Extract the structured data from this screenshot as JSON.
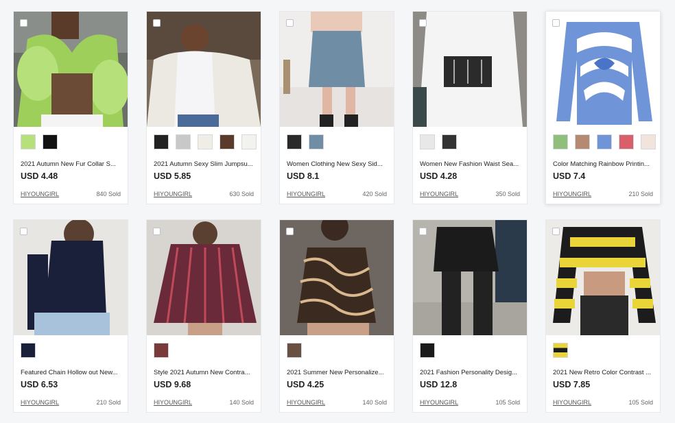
{
  "products": [
    {
      "title": "2021 Autumn New Fur Collar S...",
      "price": "USD 4.48",
      "shop": "HIYOUNGIRL",
      "sold": "840 Sold"
    },
    {
      "title": "2021 Autumn Sexy Slim Jumpsu...",
      "price": "USD 5.85",
      "shop": "HIYOUNGIRL",
      "sold": "630 Sold"
    },
    {
      "title": "Women Clothing New Sexy Sid...",
      "price": "USD 8.1",
      "shop": "HIYOUNGIRL",
      "sold": "420 Sold"
    },
    {
      "title": "Women New Fashion Waist Sea...",
      "price": "USD 4.28",
      "shop": "HIYOUNGIRL",
      "sold": "350 Sold"
    },
    {
      "title": "Color Matching Rainbow Printin...",
      "price": "USD 7.4",
      "shop": "HIYOUNGIRL",
      "sold": "210 Sold"
    },
    {
      "title": "Featured Chain Hollow out New...",
      "price": "USD 6.53",
      "shop": "HIYOUNGIRL",
      "sold": "210 Sold"
    },
    {
      "title": "Style 2021 Autumn New Contra...",
      "price": "USD 9.68",
      "shop": "HIYOUNGIRL",
      "sold": "140 Sold"
    },
    {
      "title": "2021 Summer New Personalize...",
      "price": "USD 4.25",
      "shop": "HIYOUNGIRL",
      "sold": "140 Sold"
    },
    {
      "title": "2021 Fashion Personality Desig...",
      "price": "USD 12.8",
      "shop": "HIYOUNGIRL",
      "sold": "105 Sold"
    },
    {
      "title": "2021 New Retro Color Contrast ...",
      "price": "USD 7.85",
      "shop": "HIYOUNGIRL",
      "sold": "105 Sold"
    }
  ],
  "colors": {
    "page_bg": "#f5f6f8",
    "card_border": "#e6e8ec",
    "text": "#222222"
  }
}
